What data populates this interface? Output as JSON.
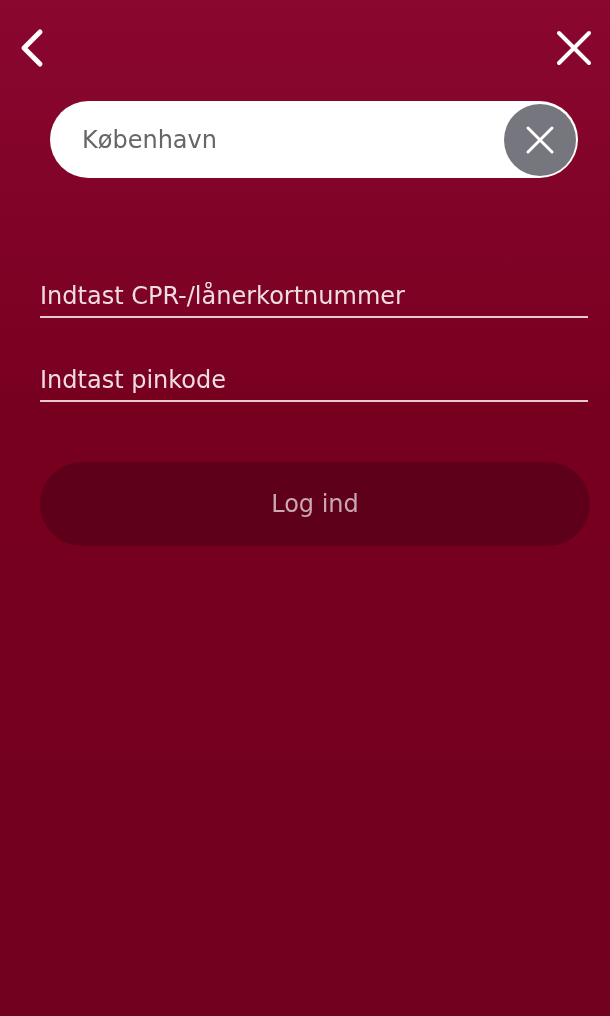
{
  "search": {
    "value": "København"
  },
  "fields": [
    {
      "placeholder": "Indtast CPR-/lånerkortnummer"
    },
    {
      "placeholder": "Indtast pinkode"
    }
  ],
  "login_button": {
    "label": "Log ind",
    "disabled": true
  }
}
